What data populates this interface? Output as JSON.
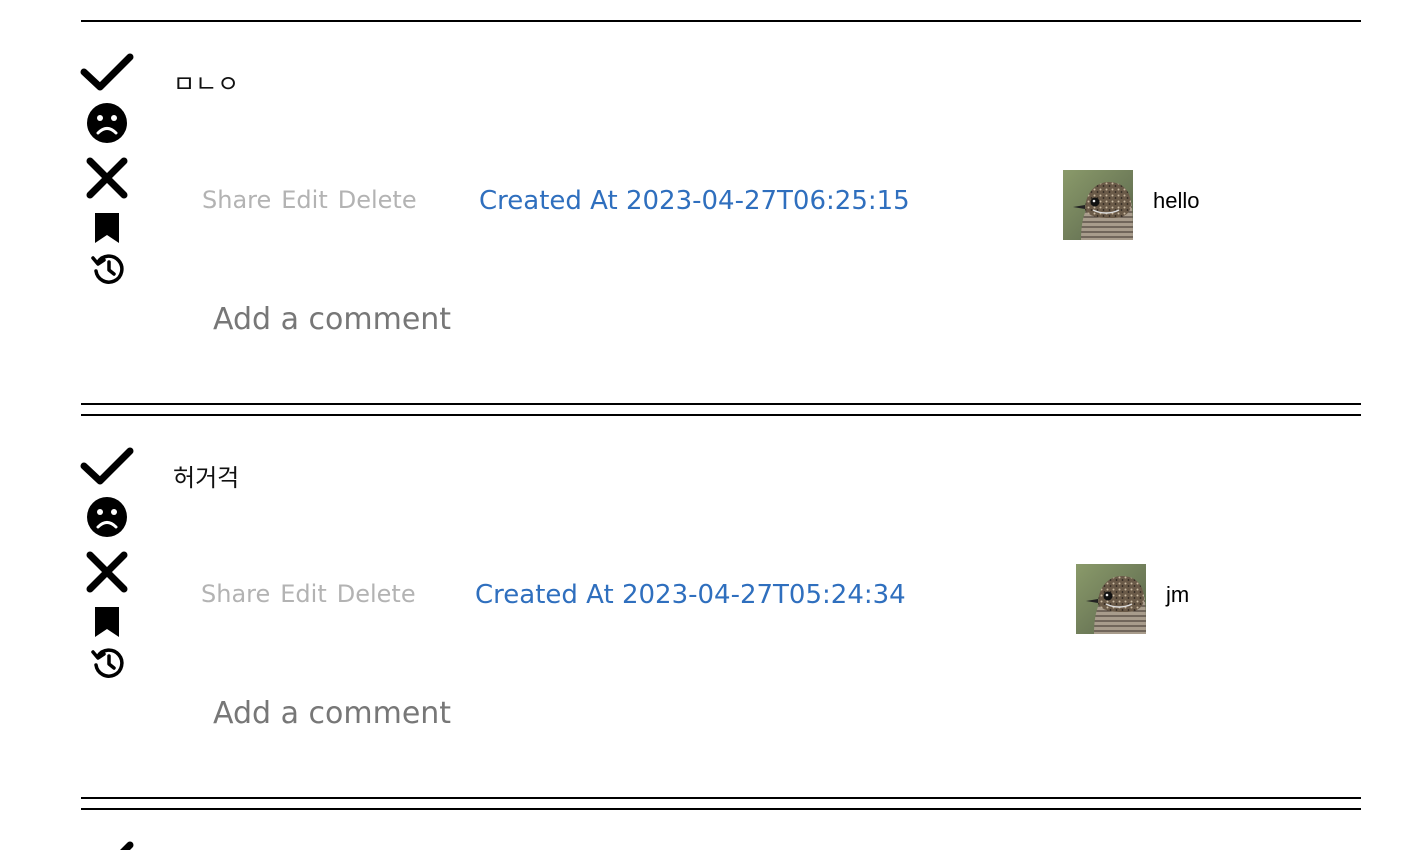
{
  "posts": [
    {
      "title": "ㅁㄴㅇ",
      "actions": {
        "share": "Share",
        "edit": "Edit",
        "delete": "Delete"
      },
      "created": "Created At 2023-04-27T06:25:15",
      "author": "hello",
      "comment_placeholder": "Add a comment"
    },
    {
      "title": "허거걱",
      "actions": {
        "share": "Share",
        "edit": "Edit",
        "delete": "Delete"
      },
      "created": "Created At 2023-04-27T05:24:34",
      "author": "jm",
      "comment_placeholder": "Add a comment"
    }
  ],
  "icons": {
    "upvote": "check-icon",
    "sad": "sad-face-icon",
    "downvote": "x-icon",
    "bookmark": "bookmark-icon",
    "history": "history-icon",
    "avatar": "bird-avatar"
  },
  "colors": {
    "link": "#2f6fbe",
    "action": "#b3b3b3",
    "placeholder": "#777777",
    "rule": "#000000"
  }
}
